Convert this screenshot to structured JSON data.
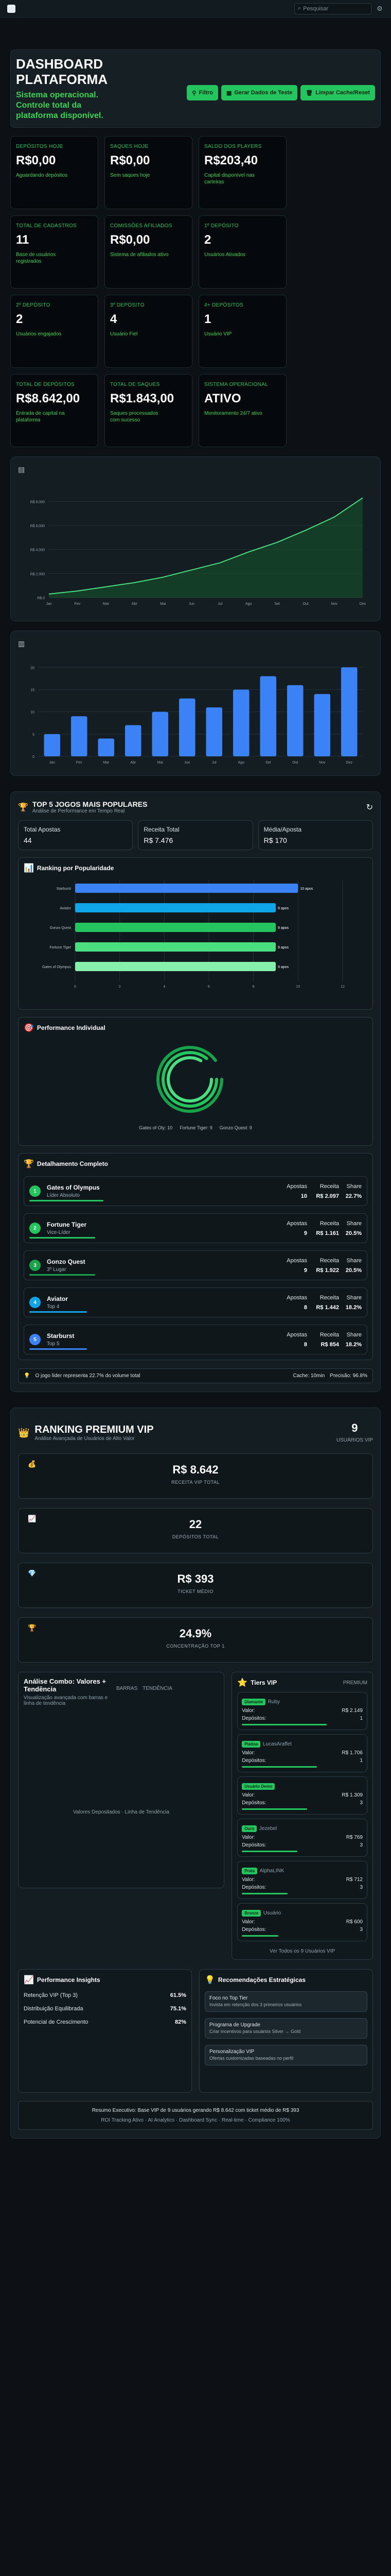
{
  "topbar": {
    "search_placeholder": "Pesquisar"
  },
  "hero": {
    "title": "DASHBOARD PLATAFORMA",
    "subtitle": "Sistema operacional. Controle total da plataforma disponível.",
    "buttons": [
      "Filtro",
      "Gerar Dados de Teste",
      "Limpar Cache/Reset"
    ]
  },
  "kpis": [
    {
      "label": "Depósitos Hoje",
      "value": "R$0,00",
      "note": "Aguardando depósitos"
    },
    {
      "label": "Saques Hoje",
      "value": "R$0,00",
      "note": "Sem saques hoje"
    },
    {
      "label": "Saldo dos Players",
      "value": "R$203,40",
      "note": "Capital disponível nas carteiras"
    },
    {
      "label": "",
      "value": "",
      "note": ""
    },
    {
      "label": "Total de Cadastros",
      "value": "11",
      "note": "Base de usuários registrados"
    },
    {
      "label": "Comissões Afiliados",
      "value": "R$0,00",
      "note": "Sistema de afiliados ativo"
    },
    {
      "label": "1º Depósito",
      "value": "2",
      "note": "Usuários Ativados"
    },
    {
      "label": "",
      "value": "",
      "note": ""
    },
    {
      "label": "2º Depósito",
      "value": "2",
      "note": "Usuários engajados"
    },
    {
      "label": "3º Depósito",
      "value": "4",
      "note": "Usuário Fiel"
    },
    {
      "label": "4+ Depósitos",
      "value": "1",
      "note": "Usuário VIP"
    },
    {
      "label": "",
      "value": "",
      "note": ""
    },
    {
      "label": "Total de Depósitos",
      "value": "R$8.642,00",
      "note": "Entrada de capital na plataforma"
    },
    {
      "label": "Total de Saques",
      "value": "R$1.843,00",
      "note": "Saques processados com sucesso"
    },
    {
      "label": "Sistema Operacional",
      "value": "ATIVO",
      "note": "Monitoramento 24/7 ativo"
    },
    {
      "label": "",
      "value": "",
      "note": ""
    }
  ],
  "chart_data": [
    {
      "type": "area",
      "title": "",
      "categories": [
        "Jan",
        "Fev",
        "Mar",
        "Abr",
        "Mai",
        "Jun",
        "Jul",
        "Ago",
        "Set",
        "Out",
        "Nov",
        "Dez"
      ],
      "values": [
        300,
        550,
        900,
        1250,
        1700,
        2300,
        2900,
        3800,
        4600,
        5600,
        6700,
        8300
      ],
      "y_ticks": [
        "R$ 0",
        "R$ 2.000",
        "R$ 4.000",
        "R$ 6.000",
        "R$ 8.000"
      ],
      "ylim": [
        0,
        9000
      ]
    },
    {
      "type": "bar",
      "title": "",
      "categories": [
        "Jan",
        "Fev",
        "Mar",
        "Abr",
        "Mai",
        "Jun",
        "Jul",
        "Ago",
        "Set",
        "Out",
        "Nov",
        "Dez"
      ],
      "values": [
        5,
        9,
        4,
        7,
        10,
        13,
        11,
        15,
        18,
        16,
        14,
        20
      ],
      "y_ticks": [
        "0",
        "5",
        "10",
        "15",
        "20"
      ],
      "ylim": [
        0,
        22
      ]
    },
    {
      "type": "bar",
      "title": "Ranking por Popularidade",
      "categories": [
        "Starburst",
        "Aviator",
        "Gonzo Quest",
        "Fortune Tiger",
        "Gates of Olympus"
      ],
      "values": [
        10,
        9,
        9,
        9,
        9
      ],
      "value_suffix": " apos"
    }
  ],
  "games": {
    "title": "TOP 5 JOGOS MAIS POPULARES",
    "subtitle": "Análise de Performance em Tempo Real",
    "summary": [
      {
        "label": "Total Apostas",
        "value": "44"
      },
      {
        "label": "Receita Total",
        "value": "R$ 7.476"
      },
      {
        "label": "Média/Aposta",
        "value": "R$ 170"
      }
    ],
    "performance_title": "Performance Individual",
    "legend": [
      "Gates of Oly: 10",
      "Fortune Tiger: 9",
      "Gonzo Quest: 9"
    ],
    "detail_title": "Detalhamento Completo",
    "col_headers": [
      "Apostas",
      "Receita",
      "Share"
    ],
    "list": [
      {
        "rank": "1",
        "name": "Gates of Olympus",
        "sub": "Líder Absoluto",
        "apostas": "10",
        "receita": "R$ 2.097",
        "share": "22.7%",
        "color": "#22c55e",
        "bar": 0.9
      },
      {
        "rank": "2",
        "name": "Fortune Tiger",
        "sub": "Vice-Líder",
        "apostas": "9",
        "receita": "R$ 1.161",
        "share": "20.5%",
        "color": "#22c55e",
        "bar": 0.8
      },
      {
        "rank": "3",
        "name": "Gonzo Quest",
        "sub": "3º Lugar",
        "apostas": "9",
        "receita": "R$ 1.922",
        "share": "20.5%",
        "color": "#16a34a",
        "bar": 0.8
      },
      {
        "rank": "4",
        "name": "Aviator",
        "sub": "Top 4",
        "apostas": "8",
        "receita": "R$ 1.442",
        "share": "18.2%",
        "color": "#0ea5e9",
        "bar": 0.7
      },
      {
        "rank": "5",
        "name": "Starburst",
        "sub": "Top 5",
        "apostas": "8",
        "receita": "R$ 854",
        "share": "18.2%",
        "color": "#3b82f6",
        "bar": 0.7
      }
    ],
    "footer": "O jogo líder representa 22.7% do volume total",
    "cache": "Cache: 10min",
    "precision": "Precisão: 96.8%"
  },
  "vip": {
    "title": "RANKING PREMIUM VIP",
    "subtitle": "Análise Avançada de Usuários de Alto Valor",
    "count": "9",
    "count_label": "USUÁRIOS VIP",
    "stats": [
      {
        "value": "R$ 8.642",
        "label": "RECEITA VIP TOTAL"
      },
      {
        "value": "22",
        "label": "DEPÓSITOS TOTAL"
      },
      {
        "value": "R$ 393",
        "label": "TICKET MÉDIO"
      },
      {
        "value": "24.9%",
        "label": "CONCENTRAÇÃO TOP 1"
      }
    ],
    "combo_title": "Análise Combo: Valores + Tendência",
    "combo_tabs": [
      "BARRAS",
      "TENDÊNCIA"
    ],
    "combo_desc": "Visualização avançada com barras e linha de tendência",
    "combo_legend": "Valores Depositados · Linha de Tendência",
    "tiers_title": "Tiers VIP",
    "tiers_badge": "PREMIUM",
    "tiers": [
      {
        "tag": "Diamante",
        "sub": "Ruby",
        "valor": "R$ 2.149",
        "dep": "1"
      },
      {
        "tag": "Platina",
        "sub": "LucasAraffet",
        "valor": "R$ 1.706",
        "dep": "1"
      },
      {
        "tag": "Usuário Demo",
        "sub": "",
        "valor": "R$ 1.309",
        "dep": "3"
      },
      {
        "tag": "Ouro",
        "sub": "Jezebel",
        "valor": "R$ 769",
        "dep": "3"
      },
      {
        "tag": "Prata",
        "sub": "AlphaLINK",
        "valor": "R$ 712",
        "dep": "3"
      },
      {
        "tag": "Bronze",
        "sub": "Usuário",
        "valor": "R$ 600",
        "dep": "3"
      }
    ],
    "tiers_footer": "Ver Todos os 9 Usuários VIP",
    "insights_title": "Performance Insights",
    "insights": [
      {
        "label": "Retenção VIP (Top 3)",
        "value": "61.5%"
      },
      {
        "label": "Distribuição Equilibrada",
        "value": "75.1%"
      },
      {
        "label": "Potencial de Crescimento",
        "value": "82%"
      }
    ],
    "recs_title": "Recomendações Estratégicas",
    "recs": [
      {
        "t": "Foco no Top Tier",
        "s": "Invista em retenção dos 3 primeiros usuários"
      },
      {
        "t": "Programa de Upgrade",
        "s": "Criar incentivos para usuários Silver → Gold"
      },
      {
        "t": "Personalização VIP",
        "s": "Ofertas customizadas baseadas no perfil"
      }
    ],
    "summary": "Resumo Executivo: Base VIP de 9 usuários gerando R$ 8.642 com ticket médio de R$ 393",
    "footer_line": "ROI Tracking Ativo · AI Analytics · Dashboard Sync · Real-time · Compliance 100%"
  }
}
